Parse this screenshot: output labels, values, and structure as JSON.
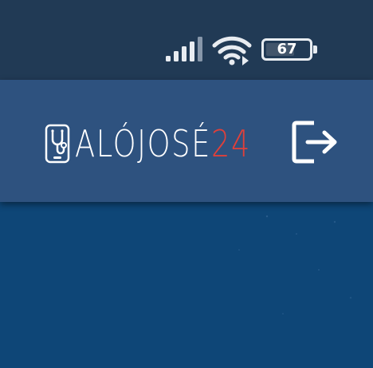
{
  "status_bar": {
    "battery_level": "67",
    "battery_fraction": 0.67,
    "icons": [
      "cellular-signal-icon",
      "wifi-icon",
      "battery-icon"
    ]
  },
  "app_bar": {
    "logo": {
      "main_text": "ALÓJOSÉ",
      "accent_text": "24",
      "icon": "stethoscope-icon"
    },
    "logout_icon": "logout-icon"
  },
  "colors": {
    "status_bar_bg": "#213a55",
    "app_bar_bg": "#2e527f",
    "content_bg": "#0e4677",
    "accent": "#e0403a",
    "foreground": "#ffffff"
  }
}
